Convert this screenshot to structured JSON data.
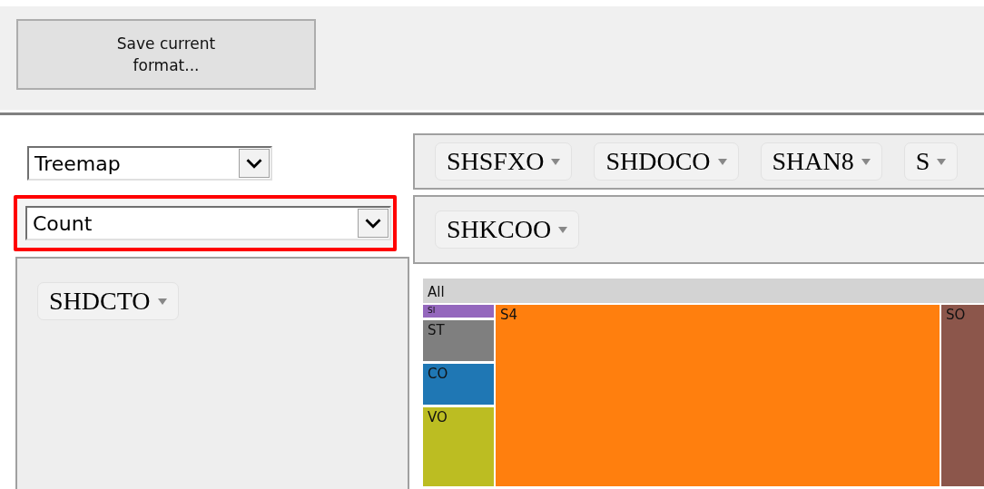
{
  "toolbar": {
    "save_button": "Save current\nformat..."
  },
  "selects": [
    {
      "value": "Treemap",
      "highlighted": false
    },
    {
      "value": "Count",
      "highlighted": true
    }
  ],
  "column_fields": [
    "SHSFXO",
    "SHDOCO",
    "SHAN8",
    "S"
  ],
  "row_fields": [
    "SHKCOO"
  ],
  "filter_fields": [
    "SHDCTO"
  ],
  "treemap": {
    "header": "All",
    "columns": [
      {
        "tiles": [
          {
            "label": "SI",
            "color": "#9467bd"
          },
          {
            "label": "ST",
            "color": "#7f7f7f"
          },
          {
            "label": "CO",
            "color": "#1f77b4"
          },
          {
            "label": "VO",
            "color": "#bcbd22"
          }
        ]
      },
      {
        "tiles": [
          {
            "label": "S4",
            "color": "#ff7f0e"
          }
        ]
      },
      {
        "tiles": [
          {
            "label": "SO",
            "color": "#8c564b"
          }
        ]
      }
    ]
  }
}
